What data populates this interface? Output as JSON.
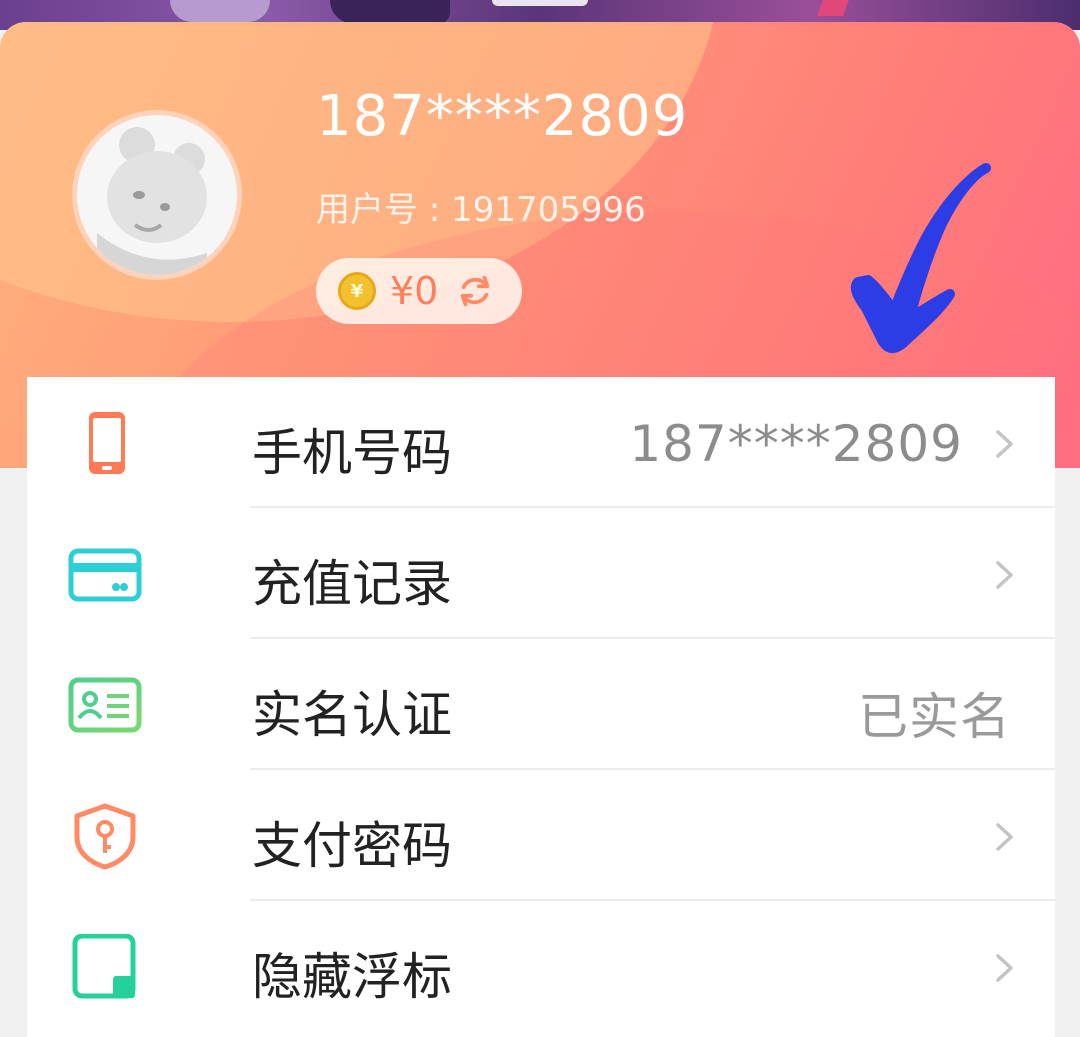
{
  "header": {
    "phone_masked": "187****2809",
    "user_id_line": "用户号 : 191705996",
    "balance": "¥0",
    "coin_symbol": "¥",
    "refresh_icon": "refresh-icon",
    "avatar_icon": "bear-avatar"
  },
  "settings": {
    "items": [
      {
        "label": "手机号码",
        "value": "187****2809",
        "icon": "phone-icon",
        "icon_color": "#ff7b56",
        "has_arrow": true
      },
      {
        "label": "充值记录",
        "value": "",
        "icon": "card-icon",
        "icon_color": "#2ccfd6",
        "has_arrow": true
      },
      {
        "label": "实名认证",
        "value": "已实名",
        "icon": "id-card-icon",
        "icon_color": "#4fcf8e",
        "has_arrow": false
      },
      {
        "label": "支付密码",
        "value": "",
        "icon": "shield-key-icon",
        "icon_color": "#ff8a66",
        "has_arrow": true
      },
      {
        "label": "隐藏浮标",
        "value": "",
        "icon": "float-hide-icon",
        "icon_color": "#25d19a",
        "has_arrow": true
      }
    ]
  },
  "colors": {
    "header_gradient_start": "#ffb27d",
    "header_gradient_end": "#ff6a84",
    "balance_text": "#ff7f5a",
    "checkmark": "#2d3de6"
  }
}
